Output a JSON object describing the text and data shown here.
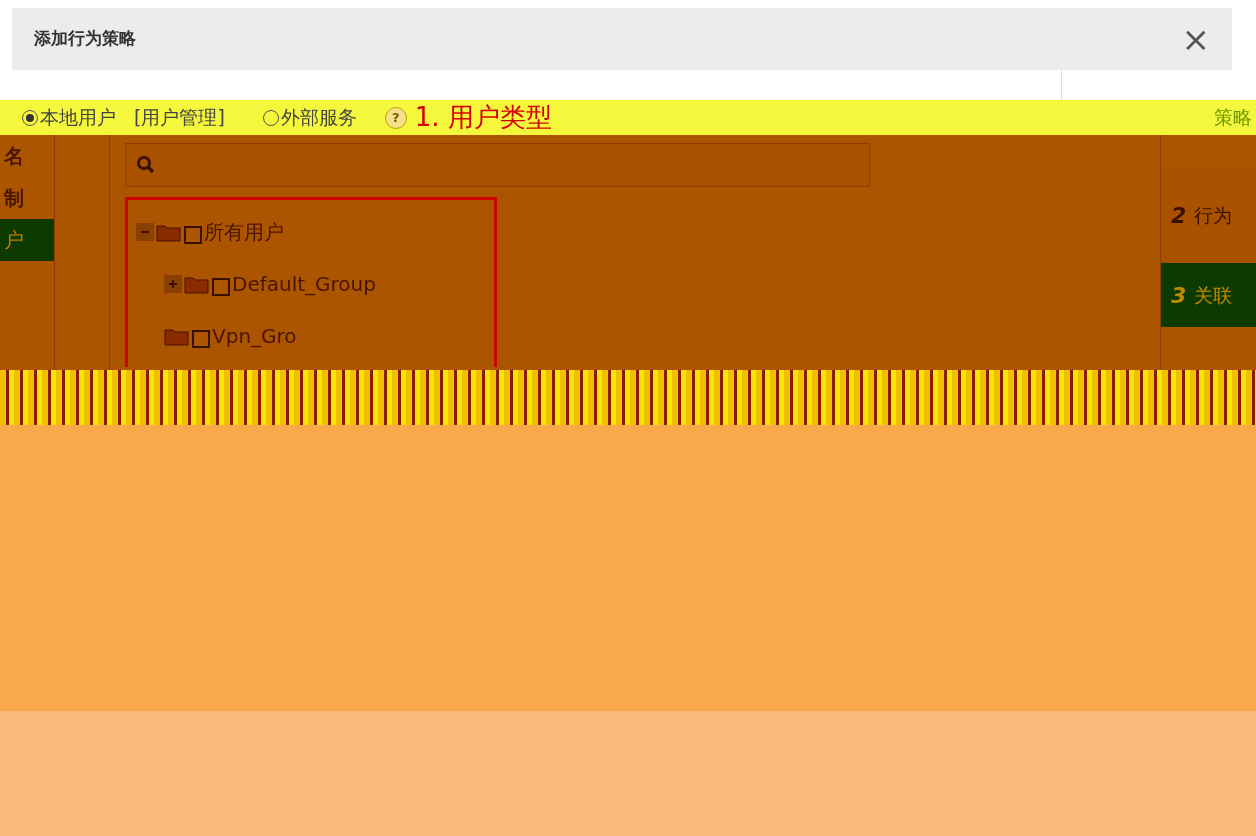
{
  "dialog": {
    "title": "添加行为策略",
    "close": "×"
  },
  "user_type": {
    "options": [
      {
        "label": "本地用户",
        "selected": true
      },
      {
        "label": "外部服务",
        "selected": false
      }
    ],
    "link": "[用户管理]",
    "help": "?",
    "annotation": [
      "1.",
      "用户类型"
    ]
  },
  "right_tab": "策略",
  "left_items": [
    {
      "label": "名",
      "selected": false
    },
    {
      "label": "制",
      "selected": false
    },
    {
      "label": "户",
      "selected": true
    }
  ],
  "tree": [
    {
      "label": "所有用户",
      "expanded": true,
      "checked": false,
      "children": [
        {
          "label": "Default_Group",
          "expanded": false,
          "checked": false
        },
        {
          "label": "Vpn_Gro",
          "checked": false
        }
      ]
    }
  ],
  "steps": [
    {
      "num": "2",
      "label": "行为",
      "selected": false
    },
    {
      "num": "3",
      "label": "关联",
      "selected": true
    }
  ]
}
